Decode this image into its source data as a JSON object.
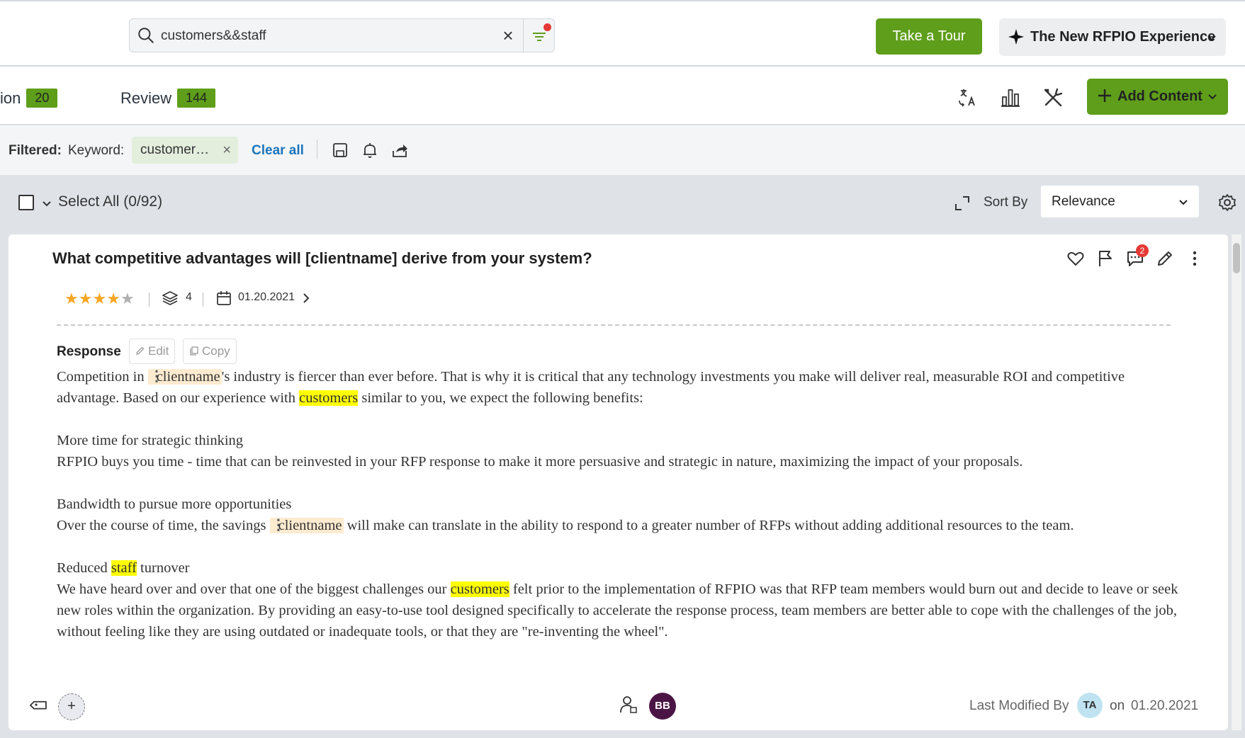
{
  "header": {
    "search": {
      "value": "customers&&staff"
    },
    "take_tour_label": "Take a Tour",
    "experience_label": "The New RFPIO Experience"
  },
  "tabs": [
    {
      "label": "ion",
      "count": "20"
    },
    {
      "label": "Review",
      "count": "144"
    }
  ],
  "toolbar": {
    "add_content_label": "Add Content"
  },
  "filters": {
    "label": "Filtered:",
    "keyword_label": "Keyword:",
    "chip_text": "customer…",
    "clear_all": "Clear all"
  },
  "selection": {
    "select_all": "Select All (0/92)",
    "sort_by_label": "Sort By",
    "sort_value": "Relevance"
  },
  "card": {
    "question": "What competitive advantages will [clientname] derive from your system?",
    "rating": 4,
    "rating_max": 5,
    "versions": "4",
    "date": "01.20.2021",
    "comment_count": "2",
    "response_label": "Response",
    "edit_label": "Edit",
    "copy_label": "Copy",
    "p1_a": "Competition in ",
    "placeholder": "clientname",
    "p1_b": "'s industry is fiercer than ever before. That is why it is critical that any technology investments you make will deliver real, measurable ROI and competitive advantage. Based on our experience with ",
    "hl_customers": "customers",
    "p1_c": " similar to you, we expect the following benefits:",
    "h2": "More time for strategic thinking",
    "p2": "RFPIO buys you time - time that can be reinvested in your RFP response to make it more persuasive and strategic in nature, maximizing the impact of your proposals.",
    "h3": "Bandwidth to pursue more opportunities",
    "p3_a": "Over the course of time, the savings ",
    "p3_b": " will make can translate in the ability to respond to a greater number of RFPs without adding additional resources to the team.",
    "h4_a": "Reduced ",
    "hl_staff": "staff",
    "h4_b": " turnover",
    "p4_a": "We have heard over and over that one of the biggest challenges our ",
    "p4_b": " felt prior to the implementation of RFPIO was that RFP team members would burn out and decide to leave or seek new roles within the organization. By providing an easy-to-use tool designed specifically to accelerate the response process, team members are better able to cope with the challenges of the job, without feeling like they are using outdated or inadequate tools, or that they are \"re-inventing the wheel\".",
    "owner_initials": "BB",
    "last_modified_label": "Last Modified By",
    "modifier_initials": "TA",
    "on_label": "on",
    "modified_date": "01.20.2021"
  },
  "colors": {
    "brand_green": "#5e9e1a",
    "link_blue": "#1b75bc",
    "highlight": "#ffff00",
    "placeholder_bg": "#fdebd0"
  }
}
